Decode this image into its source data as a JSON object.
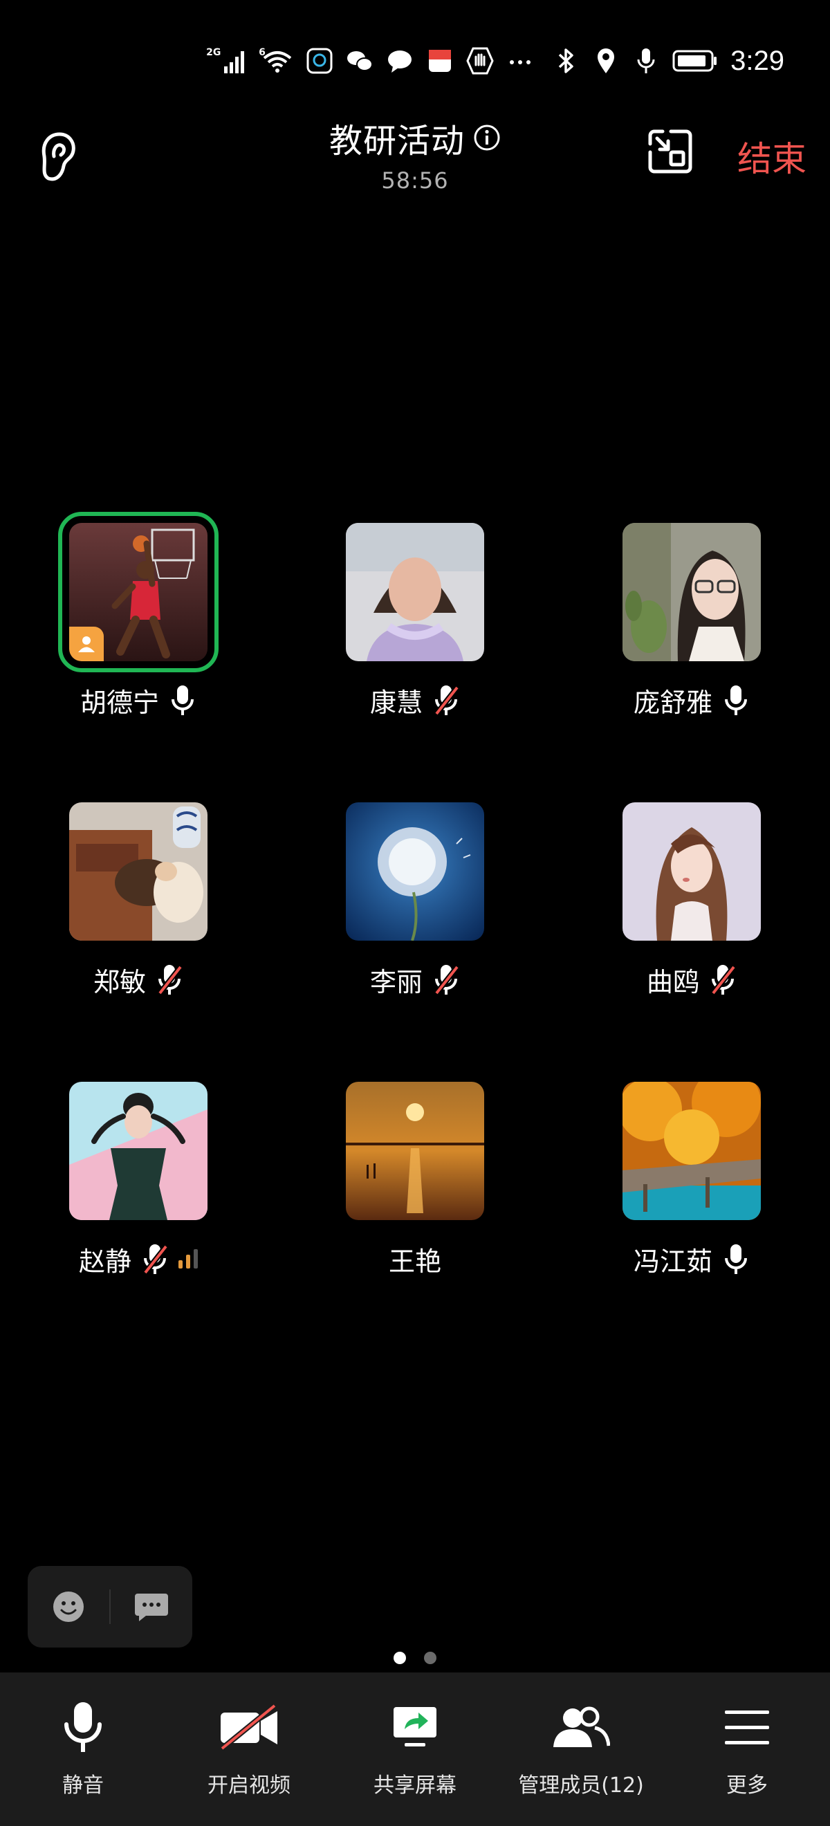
{
  "status_bar": {
    "network_2g": "2G",
    "network_6": "6",
    "time": "3:29"
  },
  "header": {
    "title": "教研活动",
    "timer": "58:56",
    "end_label": "结束"
  },
  "participants": [
    {
      "name": "胡德宁",
      "mic": "on",
      "speaking": true,
      "host": true
    },
    {
      "name": "康慧",
      "mic": "muted"
    },
    {
      "name": "庞舒雅",
      "mic": "on"
    },
    {
      "name": "郑敏",
      "mic": "muted"
    },
    {
      "name": "李丽",
      "mic": "muted"
    },
    {
      "name": "曲鸥",
      "mic": "muted"
    },
    {
      "name": "赵静",
      "mic": "muted",
      "signal_bars": 2
    },
    {
      "name": "王艳",
      "mic": "none"
    },
    {
      "name": "冯江茹",
      "mic": "on"
    }
  ],
  "pagination": {
    "current": 1,
    "total": 2
  },
  "toolbar": {
    "mute_label": "静音",
    "video_label": "开启视频",
    "share_label": "共享屏幕",
    "members_label": "管理成员(12)",
    "more_label": "更多"
  },
  "colors": {
    "background": "#000000",
    "end_red": "#f0544f",
    "speaking_green": "#20b654",
    "toolbar_bg": "#1c1c1c",
    "host_badge": "#f5a340"
  }
}
